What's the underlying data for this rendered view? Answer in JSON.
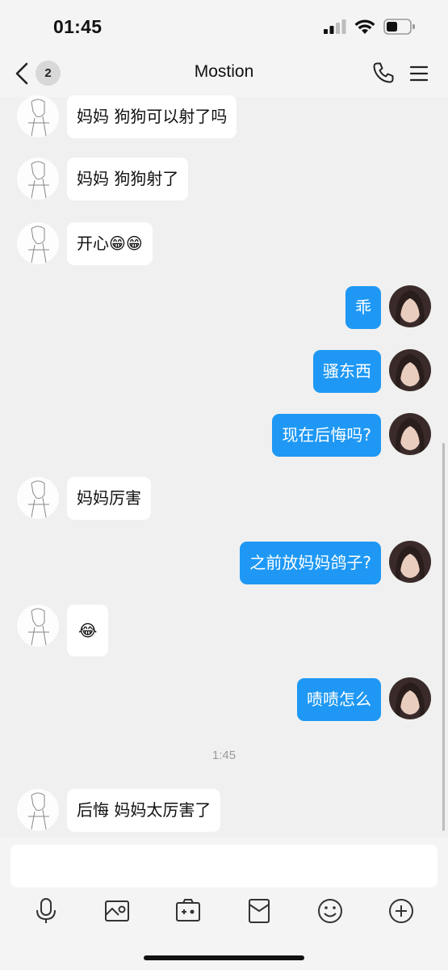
{
  "status_bar": {
    "time": "01:45"
  },
  "header": {
    "back_badge": "2",
    "title": "Mostion"
  },
  "messages": [
    {
      "dir": "in",
      "text": "妈妈 狗狗可以射了吗"
    },
    {
      "dir": "in",
      "text": "妈妈 狗狗射了"
    },
    {
      "dir": "in",
      "text": "开心😁😁"
    },
    {
      "dir": "out",
      "text": "乖"
    },
    {
      "dir": "out",
      "text": "骚东西"
    },
    {
      "dir": "out",
      "text": "现在后悔吗?"
    },
    {
      "dir": "in",
      "text": "妈妈厉害"
    },
    {
      "dir": "out",
      "text": "之前放妈妈鸽子?"
    },
    {
      "dir": "in",
      "text": "😂"
    },
    {
      "dir": "out",
      "text": "啧啧怎么"
    },
    {
      "dir": "in",
      "text": "后悔 妈妈太厉害了"
    }
  ],
  "timestamp": "1:45",
  "input": {
    "value": "",
    "placeholder": ""
  },
  "toolbar": [
    "microphone-icon",
    "image-icon",
    "camera-icon",
    "red-packet-icon",
    "emoji-icon",
    "plus-icon"
  ],
  "colors": {
    "outgoing_bubble": "#1e98f4",
    "incoming_bubble": "#ffffff",
    "background": "#f0f0f0"
  }
}
